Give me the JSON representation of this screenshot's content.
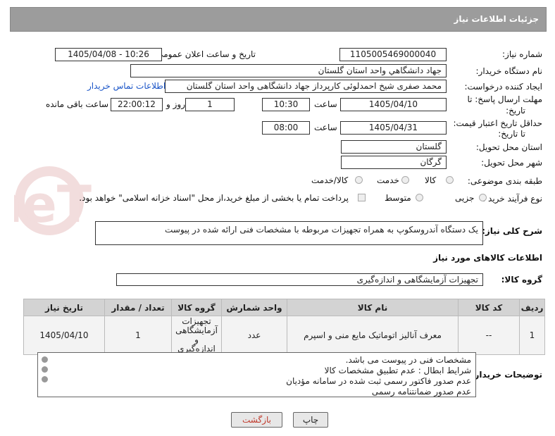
{
  "header": {
    "title": "جزئیات اطلاعات نیاز"
  },
  "fields": {
    "need_number_label": "شماره نیاز:",
    "need_number": "1105005469000040",
    "announce_label": "تاریخ و ساعت اعلان عمومی:",
    "announce_value": "1405/04/08 - 10:26",
    "buyer_org_label": "نام دستگاه خریدار:",
    "buyer_org": "جهاد دانشگاهي واحد استان گلستان",
    "requester_label": "ایجاد کننده درخواست:",
    "requester": "محمد صفری شیخ احمدلوئی کارپرداز جهاد دانشگاهی واحد استان گلستان",
    "buyer_contact_link": "اطلاعات تماس خریدار",
    "deadline_label_1": "مهلت ارسال پاسخ: تا",
    "deadline_label_2": "تاریخ:",
    "deadline_date": "1405/04/10",
    "time_label": "ساعت",
    "deadline_time": "10:30",
    "days_value": "1",
    "days_label": "روز و",
    "remaining_time": "22:00:12",
    "remaining_label": "ساعت باقی مانده",
    "min_validity_label_1": "حداقل تاریخ اعتبار قیمت:",
    "min_validity_label_2": "تا تاریخ:",
    "validity_date": "1405/04/31",
    "validity_time_label": "ساعت",
    "validity_time": "08:00",
    "province_label": "استان محل تحویل:",
    "province": "گلستان",
    "city_label": "شهر محل تحویل:",
    "city": "گرگان",
    "category_label": "طبقه بندی موضوعی:",
    "category_options": [
      "کالا",
      "خدمت",
      "کالا/خدمت"
    ],
    "process_label": "نوع فرآیند خرید :",
    "process_options": [
      "جزیی",
      "متوسط"
    ],
    "payment_note": "پرداخت تمام یا بخشی از مبلغ خرید،از محل \"اسناد خزانه اسلامی\" خواهد بود.",
    "general_desc_label": "شرح کلی نیاز:",
    "general_desc": "یک دستگاه آندروسکوپ به همراه تجهیزات مربوطه با مشخصات فنی ارائه شده در پیوست"
  },
  "goods": {
    "section_title": "اطلاعات کالاهای مورد نیاز",
    "group_label": "گروه کالا:",
    "group_value": "تجهیزات آزمایشگاهی و اندازه‌گیری",
    "columns": [
      "ردیف",
      "کد کالا",
      "نام کالا",
      "واحد شمارش",
      "گروه کالا",
      "تعداد / مقدار",
      "تاریخ نیاز"
    ],
    "row": {
      "index": "1",
      "code": "--",
      "name": "معرف آنالیز اتوماتیک مایع منی و اسپرم",
      "unit": "عدد",
      "group_lines": [
        "تجهیزات",
        "آزمایشگاهی و",
        "اندازه‌گیری"
      ],
      "quantity": "1",
      "date": "1405/04/10"
    }
  },
  "buyer_notes": {
    "label": "توضیحات خریدار:",
    "lines": [
      "مشخصات فنی در پیوست می باشد.",
      "شرایط ابطال : عدم تطبیق مشخصات کالا",
      "عدم صدور فاکتور رسمی ثبت شده در سامانه مؤدیان",
      "عدم صدور ضمانتنامه رسمی"
    ]
  },
  "buttons": {
    "print": "چاپ",
    "back": "بازگشت"
  },
  "watermark": {
    "text": "AriaTender.neT"
  },
  "colors": {
    "header_bg": "#9c9c9c",
    "link": "#1a55c8",
    "back_button_text": "#c0392b",
    "watermark": "#b03030"
  }
}
